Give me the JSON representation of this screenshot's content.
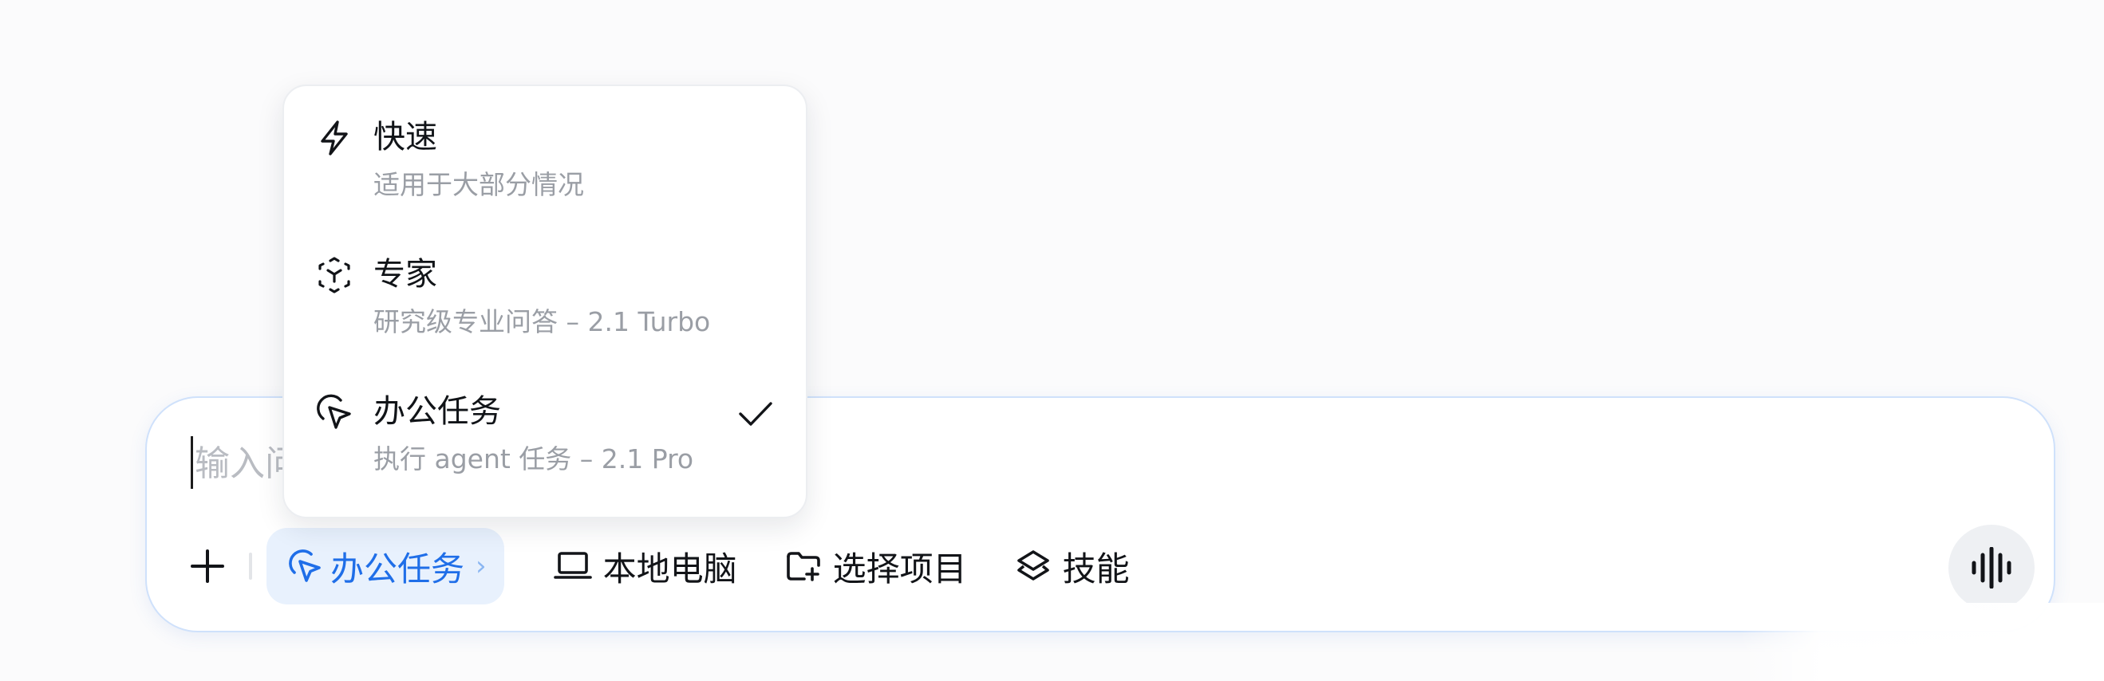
{
  "dropdown": {
    "options": [
      {
        "title": "快速",
        "subtitle": "适用于大部分情况",
        "icon": "lightning-icon",
        "selected": false
      },
      {
        "title": "专家",
        "subtitle": "研究级专业问答 – 2.1 Turbo",
        "icon": "expert-cube-icon",
        "selected": false
      },
      {
        "title": "办公任务",
        "subtitle": "执行 agent 任务 – 2.1 Pro",
        "icon": "cursor-click-icon",
        "selected": true
      }
    ]
  },
  "input": {
    "placeholder_visible": "输入问"
  },
  "toolbar": {
    "mode_label": "办公任务",
    "mode_chevron": "›",
    "local_computer_label": "本地电脑",
    "select_project_label": "选择项目",
    "skills_label": "技能"
  },
  "colors": {
    "accent": "#1f6ee8",
    "chip_bg": "#e8f1fd",
    "border": "#cfe1fb",
    "muted_text": "#9a9ea5"
  }
}
